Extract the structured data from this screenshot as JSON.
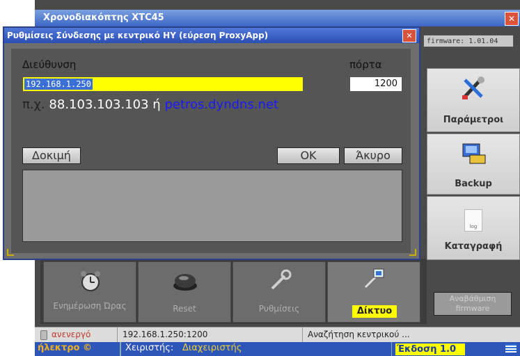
{
  "main_window": {
    "title": "Χρονοδιακόπτης XTC45",
    "close": "✕",
    "firmware": "firmware: 1.01.04"
  },
  "side_buttons": [
    {
      "label": "Παράμετροι",
      "icon": "tools-icon"
    },
    {
      "label": "Backup",
      "icon": "backup-icon"
    },
    {
      "label": "Καταγραφή",
      "icon": "log-icon",
      "icon_text": "log"
    },
    {
      "label": "Αναβάθμιση firmware",
      "icon": ""
    }
  ],
  "bottom_buttons": [
    {
      "label": "Ενημέρωση Ώρας",
      "icon": "alarm-clock-icon"
    },
    {
      "label": "Reset",
      "icon": "reset-button-icon"
    },
    {
      "label": "Ρυθμίσεις",
      "icon": "wrench-icon"
    },
    {
      "label": "Δίκτυο",
      "icon": "network-icon"
    }
  ],
  "status_bar": {
    "state": "ανενεργό",
    "address": "192.168.1.250:1200",
    "message": "Αναζήτηση κεντρικού ..."
  },
  "footer": {
    "brand": "ήλεκτρο ©",
    "operator_label": "Χειριστής:",
    "operator": "Διαχειριστής",
    "version": "Έκδοση 1.0"
  },
  "dialog": {
    "title": "Ρυθμίσεις Σύνδεσης με κεντρικό ΗΥ (εύρεση ProxyApp)",
    "close": "✕",
    "address_label": "Διεύθυνση",
    "address_value": "192.168.1.250",
    "port_label": "πόρτα",
    "port_value": "1200",
    "example_prefix": "π.χ.",
    "example_ip": "88.103.103.103",
    "example_or": "ή",
    "example_host": "petros.dyndns.net",
    "test_button": "Δοκιμή",
    "ok_button": "OK",
    "cancel_button": "Άκυρο"
  },
  "colors": {
    "title_blue": "#3c66c4",
    "address_highlight": "#ffff00",
    "network_label_bg": "#ffff00",
    "host_link": "#1a1aff"
  }
}
